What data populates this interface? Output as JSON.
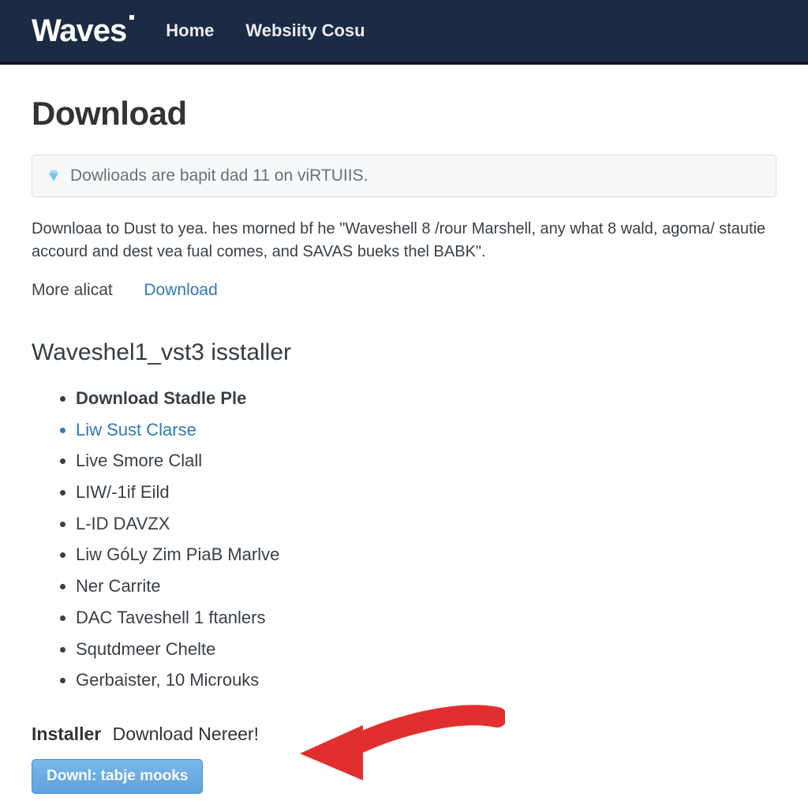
{
  "header": {
    "brand": "Waves",
    "nav": [
      {
        "label": "Home"
      },
      {
        "label": "Websiity Cosu"
      }
    ]
  },
  "page": {
    "title": "Download",
    "notice": "Dowlioads are bapit dad 11 on viRTUIIS.",
    "description": "Downloaa to Dust to yea. hes morned bf he \"Waveshell 8 /rour Marshell, any what 8 wald, agoma/ stautie accourd and dest vea fual comes, and SAVAS bueks thel BABK\".",
    "more_label": "More alicat",
    "download_link": "Download"
  },
  "section": {
    "title": "Waveshel1_vst3 isstaller",
    "items": [
      {
        "text": "Download Stadle Ple",
        "bold": true,
        "link": false
      },
      {
        "text": "Liw Sust Clarse",
        "bold": false,
        "link": true
      },
      {
        "text": "Live Smore Clall",
        "bold": false,
        "link": false
      },
      {
        "text": "LIW/-1if Eild",
        "bold": false,
        "link": false
      },
      {
        "text": "L-ID DAVZX",
        "bold": false,
        "link": false
      },
      {
        "text": "Liw GóLy Zim PiaB Marlve",
        "bold": false,
        "link": false
      },
      {
        "text": "Ner Carrite",
        "bold": false,
        "link": false
      },
      {
        "text": "DAC Taveshell 1 ftanlers",
        "bold": false,
        "link": false
      },
      {
        "text": "Squtdmeer Chelte",
        "bold": false,
        "link": false
      },
      {
        "text": "Gerbaister, 10 Microuks",
        "bold": false,
        "link": false
      }
    ]
  },
  "installer": {
    "label": "Installer",
    "text": "Download Nereer!",
    "button": "Downl: tabje mooks"
  },
  "colors": {
    "header_bg": "#1d2a44",
    "link": "#2f7ab8",
    "button_bg": "#6aaee3",
    "arrow": "#e12f2f"
  }
}
